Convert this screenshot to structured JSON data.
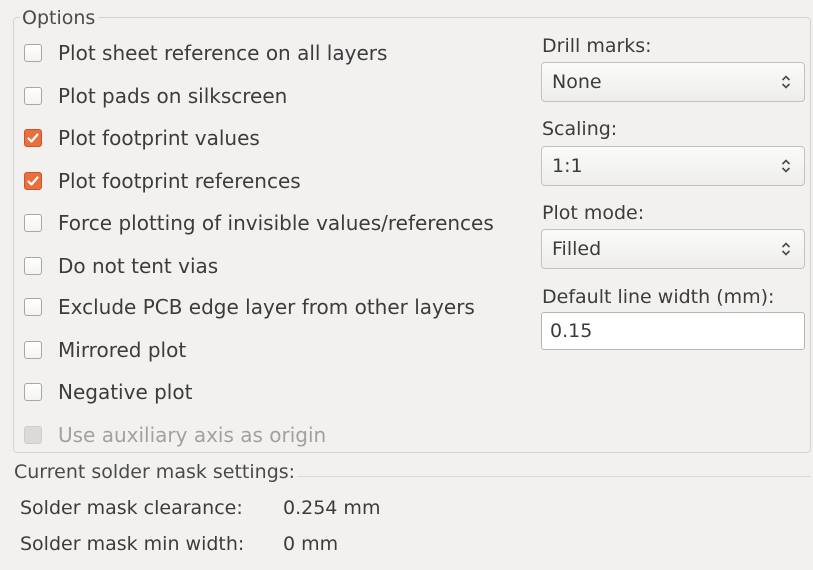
{
  "options": {
    "title": "Options",
    "checkboxes": [
      {
        "label": "Plot sheet reference on all layers",
        "checked": false,
        "enabled": true
      },
      {
        "label": "Plot pads on silkscreen",
        "checked": false,
        "enabled": true
      },
      {
        "label": "Plot footprint values",
        "checked": true,
        "enabled": true
      },
      {
        "label": "Plot footprint references",
        "checked": true,
        "enabled": true
      },
      {
        "label": "Force plotting of invisible values/references",
        "checked": false,
        "enabled": true
      },
      {
        "label": "Do not tent vias",
        "checked": false,
        "enabled": true
      },
      {
        "label": "Exclude PCB edge layer from other layers",
        "checked": false,
        "enabled": true
      },
      {
        "label": "Mirrored plot",
        "checked": false,
        "enabled": true
      },
      {
        "label": "Negative plot",
        "checked": false,
        "enabled": true
      },
      {
        "label": "Use auxiliary axis as origin",
        "checked": false,
        "enabled": false
      }
    ],
    "drill_marks": {
      "label": "Drill marks:",
      "value": "None"
    },
    "scaling": {
      "label": "Scaling:",
      "value": "1:1"
    },
    "plot_mode": {
      "label": "Plot mode:",
      "value": "Filled"
    },
    "line_width": {
      "label": "Default line width (mm):",
      "value": "0.15"
    }
  },
  "solder_mask": {
    "title": "Current solder mask settings:",
    "clearance_label": "Solder mask clearance:",
    "clearance_value": "0.254 mm",
    "min_width_label": "Solder mask min width:",
    "min_width_value": "0 mm"
  },
  "colors": {
    "checkbox_checked": "#e96f3e",
    "background": "#f2f1f0"
  },
  "icons": {
    "checkmark": "check-icon",
    "combo_arrows": "up-down-chevron-icon"
  }
}
